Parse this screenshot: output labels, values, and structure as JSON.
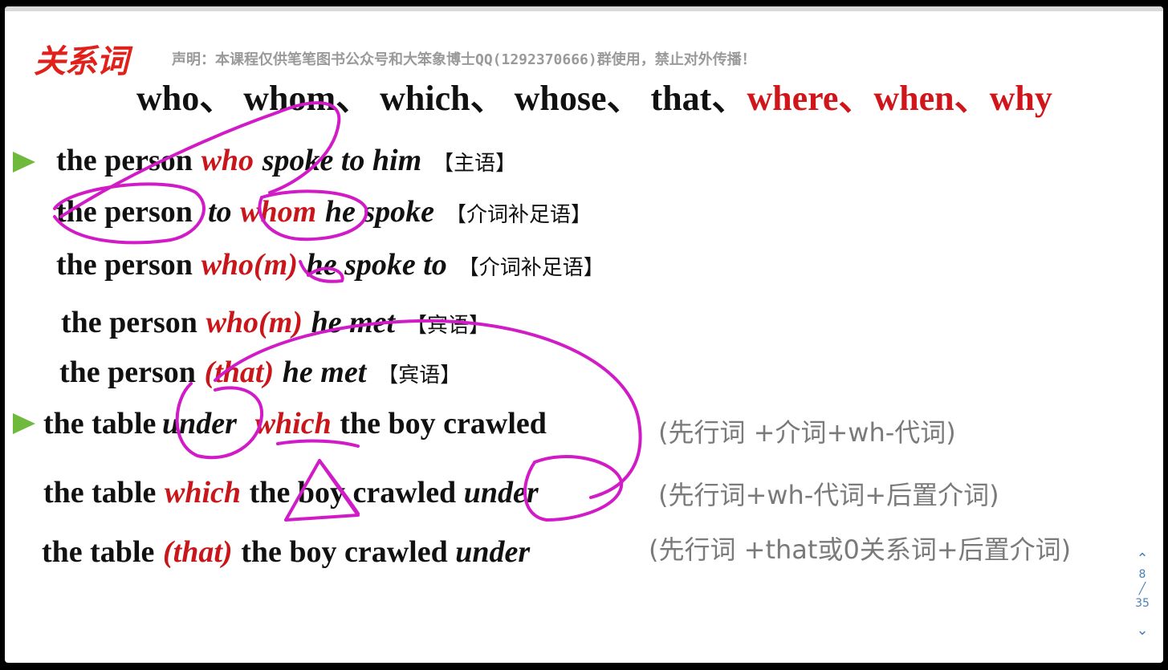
{
  "heading": "关系词",
  "notice": "声明：本课程仅供笔笔图书公众号和大笨象博士QQ(1292370666)群使用，禁止对外传播！",
  "words": {
    "black": [
      "who",
      "whom",
      "which",
      "whose",
      "that"
    ],
    "red": [
      "where",
      "when",
      "why"
    ],
    "sep": "、"
  },
  "rows": [
    {
      "pre": "the person",
      "rel": "who",
      "post": "spoke to him",
      "tag": "【主语】"
    },
    {
      "pre": "the person",
      "prep": "to",
      "rel": "whom",
      "post": "he spoke",
      "tag": "【介词补足语】"
    },
    {
      "pre": "the person",
      "rel": "who(m)",
      "post": "he spoke to",
      "tag": "【介词补足语】"
    },
    {
      "pre": "the person",
      "rel": "who(m)",
      "post": "he met",
      "tag": "【宾语】"
    },
    {
      "pre": "the person",
      "rel": "(that)",
      "post": "he met",
      "tag": "【宾语】"
    },
    {
      "pre": "the table",
      "prep": "under",
      "rel": "which",
      "post": "the boy crawled",
      "note": "(先行词 +介词+wh-代词)"
    },
    {
      "pre": "the table",
      "rel": "which",
      "post": "the boy crawled",
      "post2": "under",
      "note": "(先行词+wh-代词+后置介词)"
    },
    {
      "pre": "the table",
      "rel": "(that)",
      "post": "the boy crawled",
      "post2": "under",
      "note": "(先行词 +that或0关系词+后置介词)"
    }
  ],
  "nav": {
    "current": "8",
    "sep": "╱",
    "total": "35"
  },
  "colors": {
    "heading": "#e0201b",
    "relword": "#c8161b",
    "ink": "#d11bc7",
    "bullet": "#6fba3d",
    "nav": "#4a7fb5"
  },
  "icons": {
    "bullet": "play-triangle-icon",
    "prev": "chevron-up-icon",
    "next": "chevron-down-icon"
  }
}
